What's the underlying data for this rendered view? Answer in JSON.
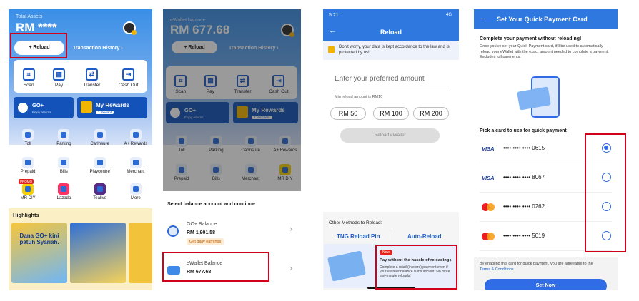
{
  "p1": {
    "total_assets_label": "Total Assets",
    "balance": "RM ****",
    "reload": "+ Reload",
    "txn_history": "Transaction History ›",
    "quick": [
      {
        "label": "Scan",
        "icon": "scan-icon"
      },
      {
        "label": "Pay",
        "icon": "qr-code-icon"
      },
      {
        "label": "Transfer",
        "icon": "transfer-icon"
      },
      {
        "label": "Cash Out",
        "icon": "cash-out-icon"
      }
    ],
    "go_plus": {
      "title": "GO+",
      "sub": "Enjoy returns"
    },
    "my_rewards": {
      "title": "My Rewards",
      "sub": "1 Reward"
    },
    "grid": [
      [
        "Toll",
        "Parking",
        "CarInsure",
        "A+ Rewards"
      ],
      [
        "Prepaid",
        "Bills",
        "Playcentre",
        "Merchant"
      ],
      [
        "MR DIY",
        "Lazada",
        "Tealive",
        "More"
      ]
    ],
    "promo_tag": "PROMO",
    "highlights": "Highlights",
    "banner1": "Dana GO+ kini patuh Syariah."
  },
  "p2": {
    "ewallet_label": "eWallet balance",
    "balance": "RM 677.68",
    "reload": "+ Reload",
    "txn_history": "Transaction History ›",
    "quick": [
      "Scan",
      "Pay",
      "Transfer",
      "Cash Out"
    ],
    "go_plus": {
      "title": "GO+",
      "sub": "Enjoy returns"
    },
    "my_rewards": {
      "title": "My Rewards",
      "sub": "1 Vouchers"
    },
    "grid": [
      [
        "Toll",
        "Parking",
        "CarInsure",
        "A+ Rewards"
      ],
      [
        "Prepaid",
        "Bills",
        "Merchant",
        "MR DIY"
      ]
    ],
    "sheet_title": "Select balance account and continue:",
    "go_plus_balance": {
      "name": "GO+ Balance",
      "value": "RM 1,901.58",
      "earn": "Get daily earnings"
    },
    "ewallet_balance": {
      "name": "eWallet Balance",
      "value": "RM 677.68"
    }
  },
  "p3": {
    "time": "5:21",
    "signal": "4G",
    "title": "Reload",
    "note": "Don't worry, your data is kept accordance to the law and is protected by us!",
    "placeholder": "Enter your preferred amount",
    "min": "Min reload amount is RM10",
    "chips": [
      "RM 50",
      "RM 100",
      "RM 200"
    ],
    "reload_btn": "Reload eWallet",
    "other": "Other Methods to Reload:",
    "pin": "TNG Reload Pin",
    "auto": "Auto-Reload",
    "ad": {
      "badge": "New",
      "title": "Pay without the hassle of reloading",
      "body": "Complete a retail (in store) payment even if your eWallet balance is insufficient. No more last-minute reloads!"
    }
  },
  "p4": {
    "title": "Set Your Quick Payment Card",
    "heading": "Complete your payment without reloading!",
    "desc": "Once you've set your Quick Payment card, it'll be used to automatically reload your eWallet with the exact amount needed to complete a payment. Excludes toll payments.",
    "pick": "Pick a card to use for quick payment",
    "cards": [
      {
        "brand": "VISA",
        "num": "•••• •••• •••• 0615"
      },
      {
        "brand": "VISA",
        "num": "•••• •••• •••• 8067"
      },
      {
        "brand": "MC",
        "num": "•••• •••• •••• 0262"
      },
      {
        "brand": "MC",
        "num": "•••• •••• •••• 5019"
      }
    ],
    "footer": "By enabling this card for quick payment, you are agreeable to the",
    "terms": "Terms & Conditions",
    "set_now": "Set Now"
  }
}
